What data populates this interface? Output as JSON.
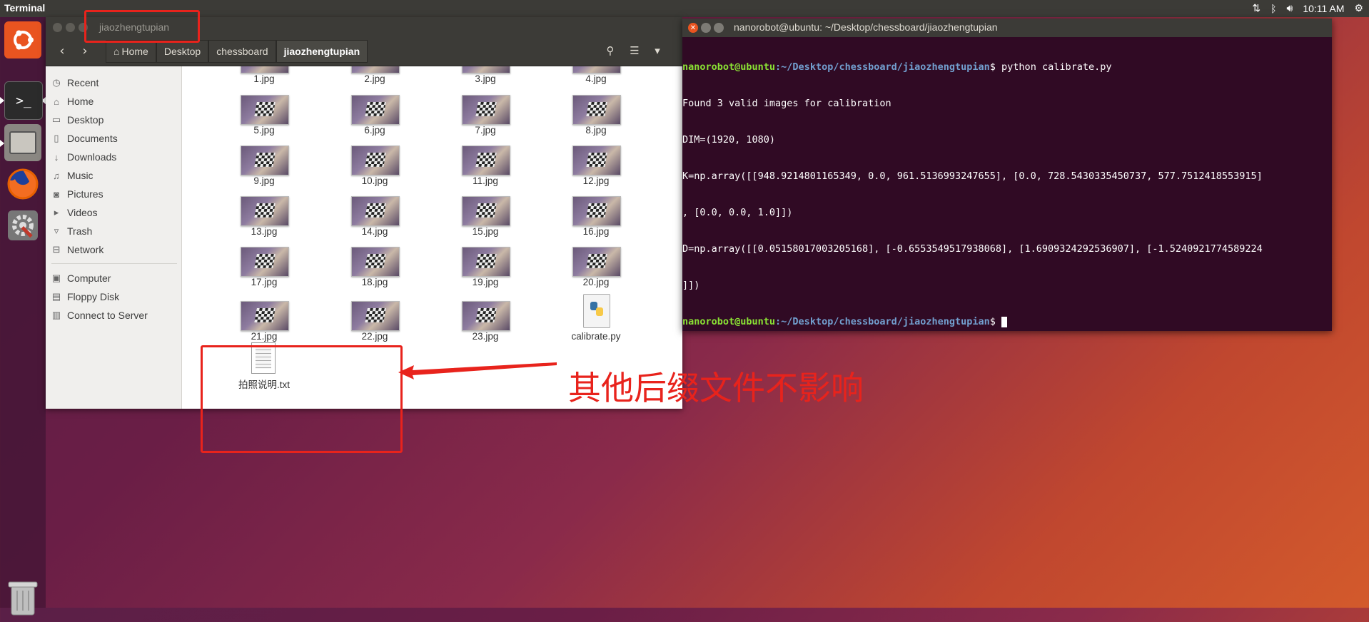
{
  "topbar": {
    "app_name": "Terminal",
    "time": "10:11 AM",
    "icons": [
      "network-icon",
      "bluetooth-icon",
      "volume-icon",
      "settings-gear-icon"
    ]
  },
  "launcher": {
    "items": [
      "ubuntu-logo-icon",
      "terminal-icon",
      "files-icon",
      "firefox-icon",
      "settings-icon"
    ],
    "trash": "trash-icon"
  },
  "file_manager": {
    "title": "jiaozhengtupian",
    "breadcrumbs": [
      "Home",
      "Desktop",
      "chessboard",
      "jiaozhengtupian"
    ],
    "sidebar": {
      "places": [
        {
          "label": "Recent",
          "icon": "clock-icon"
        },
        {
          "label": "Home",
          "icon": "home-icon"
        },
        {
          "label": "Desktop",
          "icon": "folder-icon"
        },
        {
          "label": "Documents",
          "icon": "document-icon"
        },
        {
          "label": "Downloads",
          "icon": "download-icon"
        },
        {
          "label": "Music",
          "icon": "music-icon"
        },
        {
          "label": "Pictures",
          "icon": "camera-icon"
        },
        {
          "label": "Videos",
          "icon": "video-icon"
        },
        {
          "label": "Trash",
          "icon": "trash-icon"
        },
        {
          "label": "Network",
          "icon": "network-icon"
        }
      ],
      "devices": [
        {
          "label": "Computer",
          "icon": "computer-icon"
        },
        {
          "label": "Floppy Disk",
          "icon": "disk-icon"
        },
        {
          "label": "Connect to Server",
          "icon": "server-icon"
        }
      ]
    },
    "files": [
      "1.jpg",
      "2.jpg",
      "3.jpg",
      "4.jpg",
      "5.jpg",
      "6.jpg",
      "7.jpg",
      "8.jpg",
      "9.jpg",
      "10.jpg",
      "11.jpg",
      "12.jpg",
      "13.jpg",
      "14.jpg",
      "15.jpg",
      "16.jpg",
      "17.jpg",
      "18.jpg",
      "19.jpg",
      "20.jpg",
      "21.jpg",
      "22.jpg",
      "23.jpg",
      "calibrate.py",
      "拍照说明.txt"
    ]
  },
  "terminal": {
    "title": "nanorobot@ubuntu: ~/Desktop/chessboard/jiaozhengtupian",
    "prompt_user": "nanorobot@ubuntu",
    "prompt_path": ":~/Desktop/chessboard/jiaozhengtupian",
    "prompt_sign": "$",
    "command": " python calibrate.py",
    "output": [
      "Found 3 valid images for calibration",
      "DIM=(1920, 1080)",
      "K=np.array([[948.9214801165349, 0.0, 961.5136993247655], [0.0, 728.5430335450737, 577.7512418553915]",
      ", [0.0, 0.0, 1.0]])",
      "D=np.array([[0.05158017003205168], [-0.6553549517938068], [1.6909324292536907], [-1.5240921774589224",
      "]])"
    ]
  },
  "annotation": {
    "text": "其他后缀文件不影响",
    "color": "#e8231c"
  }
}
